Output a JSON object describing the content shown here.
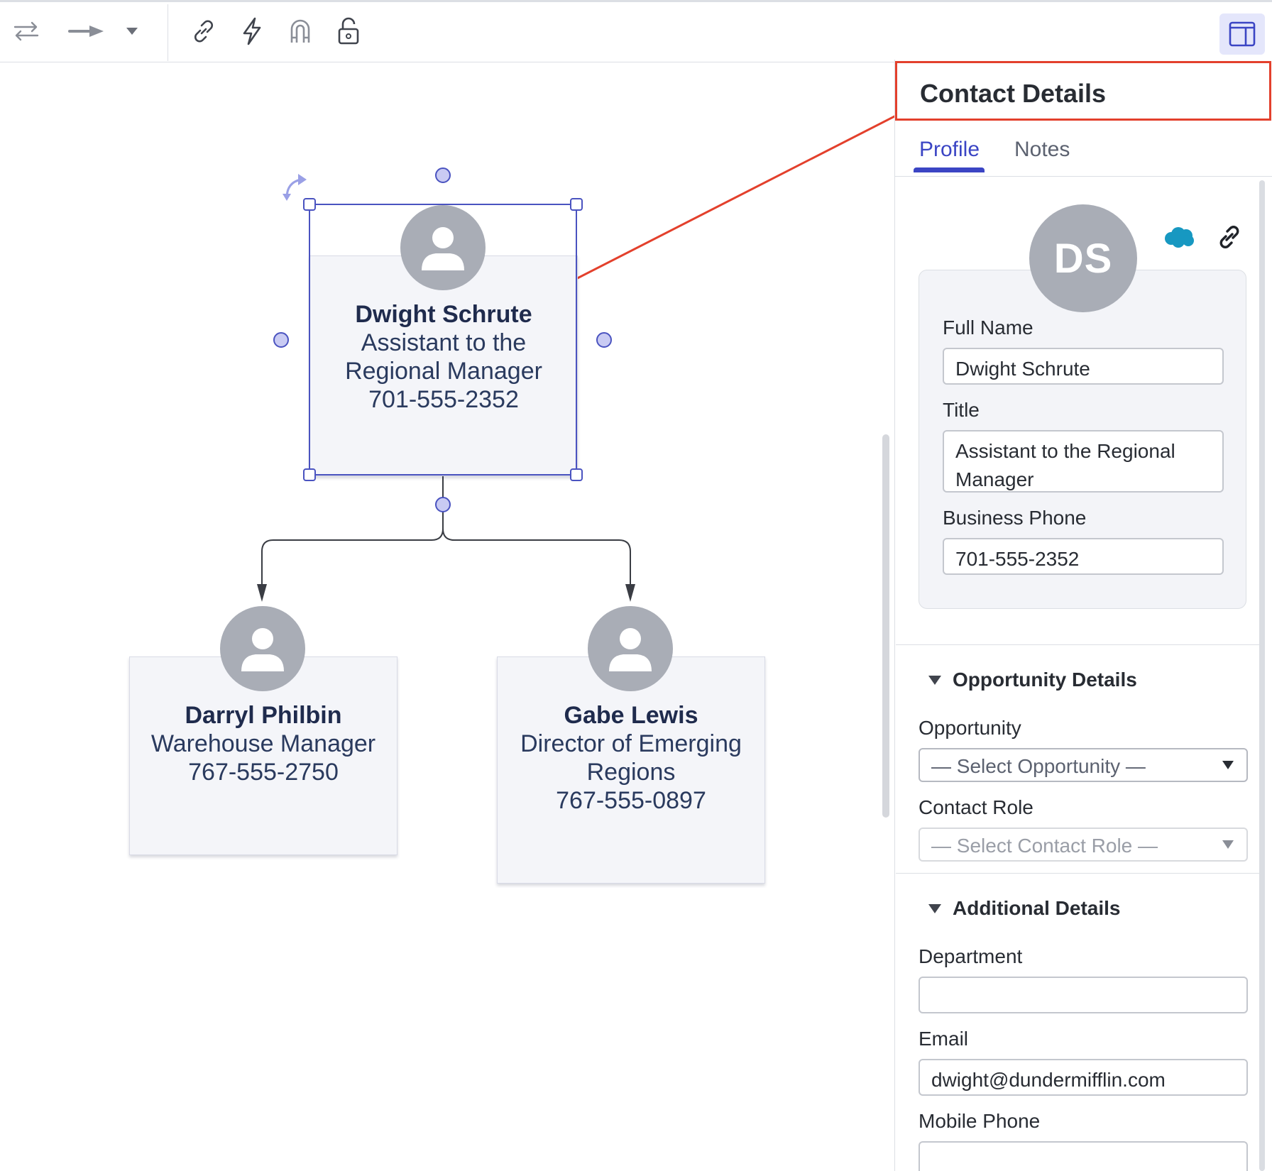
{
  "toolbar": {
    "icons": [
      "swap-arrows-icon",
      "arrow-right-icon",
      "caret-down-icon",
      "link-icon",
      "lightning-icon",
      "magnet-icon",
      "unlock-icon",
      "panel-layout-icon"
    ]
  },
  "canvas": {
    "cards": [
      {
        "name": "Dwight Schrute",
        "lines": [
          "Assistant to the",
          "Regional Manager",
          "701-555-2352"
        ]
      },
      {
        "name": "Darryl Philbin",
        "lines": [
          "Warehouse Manager",
          "767-555-2750"
        ]
      },
      {
        "name": "Gabe Lewis",
        "lines": [
          "Director of Emerging",
          "Regions",
          "767-555-0897"
        ]
      }
    ]
  },
  "panel": {
    "title": "Contact Details",
    "tabs": [
      {
        "label": "Profile",
        "active": true
      },
      {
        "label": "Notes",
        "active": false
      }
    ],
    "avatar_initials": "DS",
    "profile": {
      "full_name_label": "Full Name",
      "full_name_value": "Dwight Schrute",
      "title_label": "Title",
      "title_value": "Assistant to the Regional Manager",
      "phone_label": "Business Phone",
      "phone_value": "701-555-2352"
    },
    "opportunity": {
      "heading": "Opportunity Details",
      "opportunity_label": "Opportunity",
      "opportunity_select": "— Select Opportunity —",
      "role_label": "Contact Role",
      "role_select": "— Select Contact Role —"
    },
    "additional": {
      "heading": "Additional Details",
      "department_label": "Department",
      "department_value": "",
      "email_label": "Email",
      "email_value": "dwight@dundermifflin.com",
      "mobile_label": "Mobile Phone",
      "mobile_value": ""
    }
  },
  "colors": {
    "accent": "#3b45c4",
    "highlight": "#e3402c",
    "selection": "#4a53c0",
    "card_bg": "#f4f5f9",
    "avatar_gray": "#a9adb6",
    "salesforce_blue": "#1798c1"
  }
}
